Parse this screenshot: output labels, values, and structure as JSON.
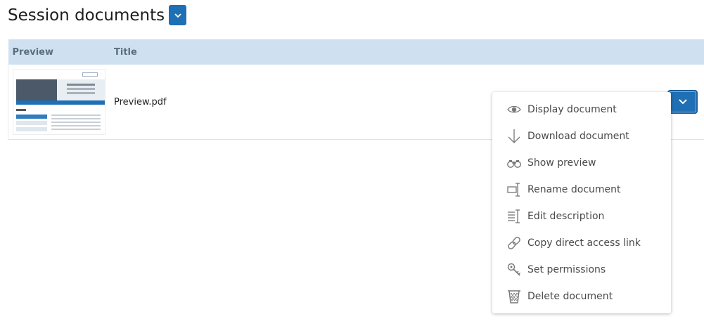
{
  "header": {
    "title": "Session documents"
  },
  "table": {
    "columns": [
      "Preview",
      "Title"
    ],
    "rows": [
      {
        "title": "Preview.pdf"
      }
    ]
  },
  "menu": {
    "items": [
      {
        "label": "Display document",
        "icon": "eye-icon"
      },
      {
        "label": "Download document",
        "icon": "download-arrow-icon"
      },
      {
        "label": "Show preview",
        "icon": "binoculars-icon"
      },
      {
        "label": "Rename document",
        "icon": "rename-icon"
      },
      {
        "label": "Edit description",
        "icon": "edit-text-icon"
      },
      {
        "label": "Copy direct access link",
        "icon": "link-icon"
      },
      {
        "label": "Set permissions",
        "icon": "key-icon"
      },
      {
        "label": "Delete document",
        "icon": "trash-icon"
      }
    ]
  },
  "colors": {
    "accent": "#1f6fb5",
    "header_bg": "#cfe1f0",
    "icon": "#777777"
  }
}
